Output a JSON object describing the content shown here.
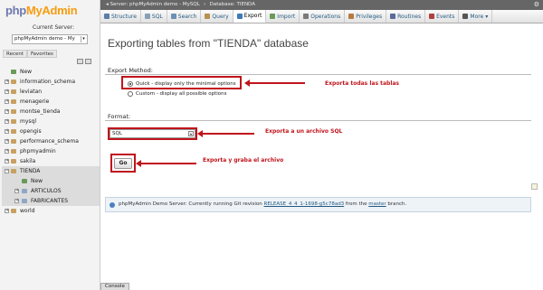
{
  "logo": {
    "part1": "php",
    "part2": "MyAdmin"
  },
  "sidebar": {
    "current_server_label": "Current Server:",
    "server_select_value": "phpMyAdmin demo - My",
    "tabs": [
      "Recent",
      "Favorites"
    ],
    "databases": [
      {
        "name": "New",
        "kind": "new"
      },
      {
        "name": "information_schema",
        "kind": "db"
      },
      {
        "name": "leviatan",
        "kind": "db"
      },
      {
        "name": "menagerie",
        "kind": "db"
      },
      {
        "name": "montse_tienda",
        "kind": "db"
      },
      {
        "name": "mysql",
        "kind": "db"
      },
      {
        "name": "opengis",
        "kind": "db"
      },
      {
        "name": "performance_schema",
        "kind": "db"
      },
      {
        "name": "phpmyadmin",
        "kind": "db"
      },
      {
        "name": "sakila",
        "kind": "db"
      },
      {
        "name": "TIENDA",
        "kind": "db-active"
      },
      {
        "name": "New",
        "kind": "sub-new"
      },
      {
        "name": "ARTICULOS",
        "kind": "sub"
      },
      {
        "name": "FABRICANTES",
        "kind": "sub"
      },
      {
        "name": "world",
        "kind": "db"
      }
    ],
    "console_label": "Console"
  },
  "breadcrumb": {
    "server": "Server: phpMyAdmin demo - MySQL",
    "database": "Database: TIENDA"
  },
  "tabs": [
    {
      "label": "Structure",
      "color": "#5a7fa8",
      "active": false
    },
    {
      "label": "SQL",
      "color": "#8aa0b8",
      "active": false
    },
    {
      "label": "Search",
      "color": "#6d8fb5",
      "active": false
    },
    {
      "label": "Query",
      "color": "#b89050",
      "active": false
    },
    {
      "label": "Export",
      "color": "#3f79b8",
      "active": true
    },
    {
      "label": "Import",
      "color": "#6a9a5a",
      "active": false
    },
    {
      "label": "Operations",
      "color": "#7a7a7a",
      "active": false
    },
    {
      "label": "Privileges",
      "color": "#b87a40",
      "active": false
    },
    {
      "label": "Routines",
      "color": "#5a6a9a",
      "active": false
    },
    {
      "label": "Events",
      "color": "#b04040",
      "active": false
    },
    {
      "label": "More",
      "color": "#555555",
      "active": false
    }
  ],
  "main": {
    "title": "Exporting tables from \"TIENDA\" database",
    "export_method_label": "Export Method:",
    "method_quick": "Quick - display only the minimal options",
    "method_custom": "Custom - display all possible options",
    "format_label": "Format:",
    "format_value": "SQL",
    "go_label": "Go",
    "notice_prefix": "phpMyAdmin Demo Server: Currently running Git revision ",
    "notice_revision": "RELEASE_4_4_1-1698-g5c78ad3",
    "notice_from": " from the ",
    "notice_branch": "master",
    "notice_suffix": " branch."
  },
  "annotations": {
    "method": "Exporta todas las tablas",
    "format": "Exporta a un  archivo SQL",
    "go": "Exporta y graba el archivo"
  },
  "colors": {
    "annotation_red": "#c0141b",
    "link": "#235a81"
  }
}
